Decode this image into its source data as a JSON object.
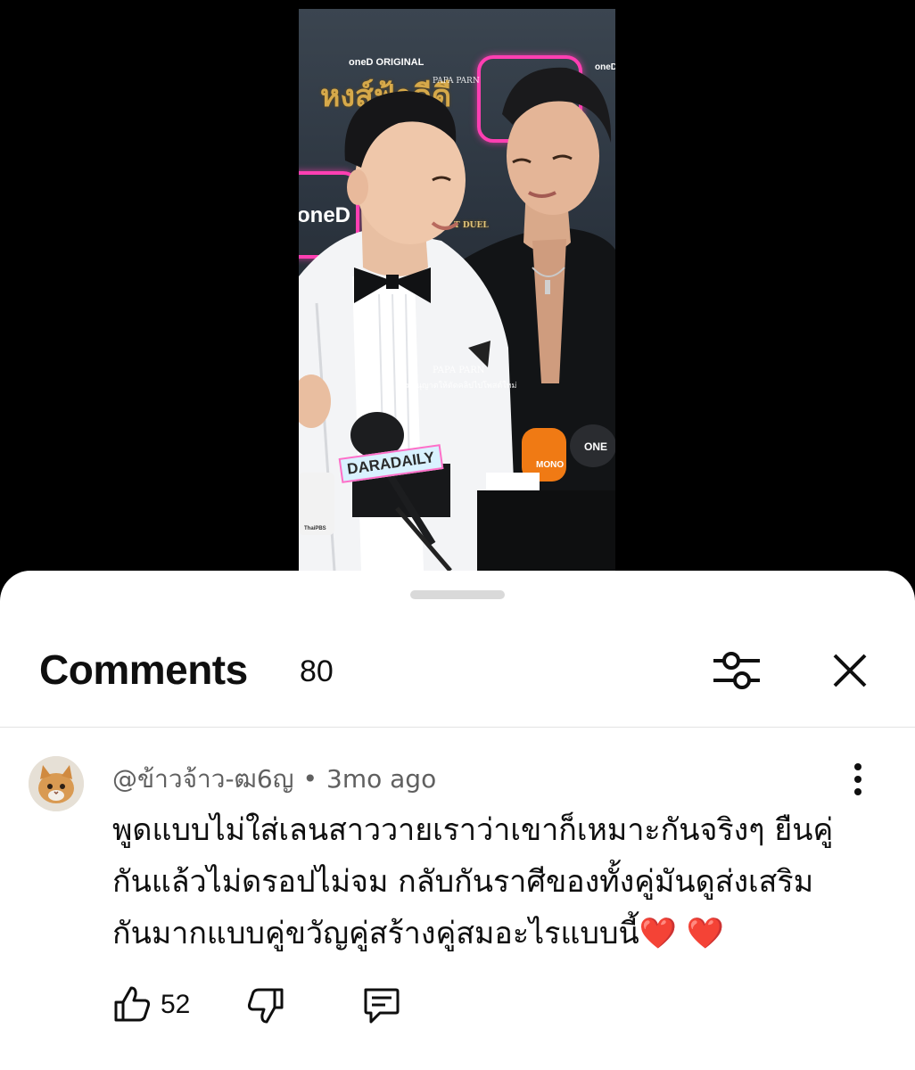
{
  "video": {
    "backdrop_brand": "oneD ORIGINAL",
    "backdrop_brand_short": "oneD",
    "show_title": "หงส์ฟ้าดีดี",
    "show_subtitle": "T DUEL",
    "watermark_top": "PAPA PARN",
    "watermark_center": "PAPA PARN",
    "watermark_notice": "ไม่อนุญาตให้ตัดคลิปไปโพสต์ใหม่",
    "mic_labels": [
      "DARADAILY",
      "MONO",
      "ThaiPBS",
      "ONE"
    ]
  },
  "comments_panel": {
    "title": "Comments",
    "count": "80",
    "filter_icon": "sliders-icon",
    "close_icon": "close-icon"
  },
  "comment": {
    "author": "@ข้าวจ้าว-ฒ6ญ",
    "separator": "•",
    "time": "3mo ago",
    "text": "พูดแบบไม่ใส่เลนสาววายเราว่าเขาก็เหมาะกันจริงๆ ยืนคู่กันแล้วไม่ดรอปไม่จม กลับกันราศีของทั้งคู่มันดูส่งเสริมกันมากแบบคู่ขวัญคู่สร้างคู่สมอะไรแบบนี้",
    "emoji": "❤️ ❤️",
    "likes": "52",
    "menu_icon": "more-vertical-icon",
    "like_icon": "thumbs-up-icon",
    "dislike_icon": "thumbs-down-icon",
    "reply_icon": "reply-icon"
  },
  "colors": {
    "sheet_bg": "#ffffff",
    "text_primary": "#0f0f0f",
    "text_secondary": "#606060",
    "heart": "#e3182d",
    "backdrop_neon": "#ff3fb2"
  }
}
